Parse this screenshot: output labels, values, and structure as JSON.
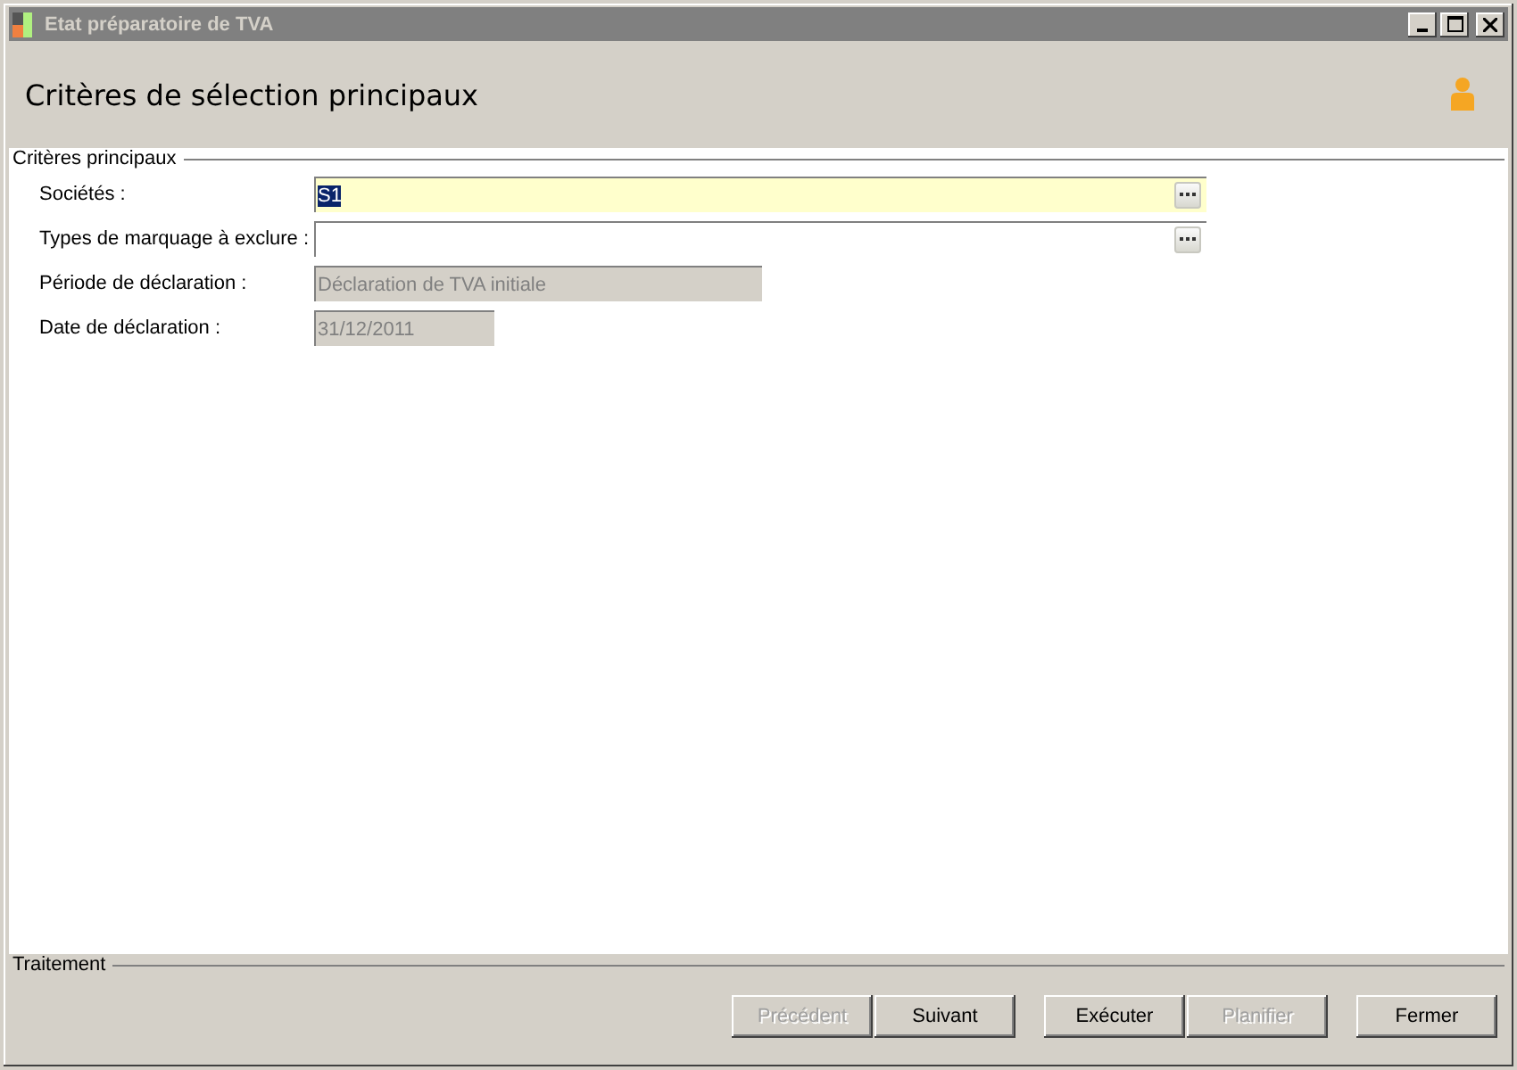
{
  "window": {
    "title": "Etat préparatoire de TVA"
  },
  "header": {
    "title": "Critères de sélection principaux"
  },
  "criteria": {
    "legend": "Critères principaux",
    "fields": [
      {
        "label": "Sociétés :",
        "value": "S1",
        "kind": "lookup",
        "focused": true,
        "disabled": false,
        "selected_text": true
      },
      {
        "label": "Types de marquage à exclure :",
        "kind": "lookup",
        "focused": false,
        "disabled": false
      },
      {
        "label": "Période de déclaration :",
        "value": "Déclaration de TVA initiale",
        "kind": "text",
        "focused": false,
        "disabled": true,
        "selected_text": false
      },
      {
        "label": "Date de déclaration :",
        "value": "31/12/2011",
        "kind": "date",
        "focused": false,
        "disabled": true,
        "selected_text": false
      }
    ]
  },
  "processing": {
    "legend": "Traitement",
    "button_groups": [
      [
        {
          "label": "Précédent",
          "disabled": true
        },
        {
          "label": "Suivant",
          "disabled": false
        }
      ],
      [
        {
          "label": "Exécuter",
          "disabled": false
        },
        {
          "label": "Planifier",
          "disabled": true
        }
      ],
      [
        {
          "label": "Fermer",
          "disabled": false
        }
      ]
    ]
  }
}
